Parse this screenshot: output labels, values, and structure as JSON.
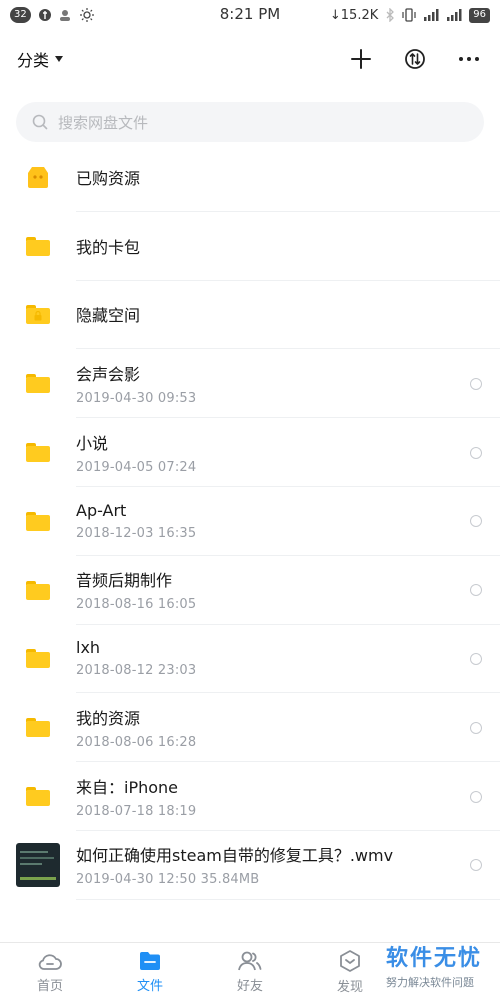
{
  "status_bar": {
    "notif_count": "32",
    "time": "8:21 PM",
    "net_speed": "↓15.2K",
    "battery": "96"
  },
  "header": {
    "category_label": "分类"
  },
  "search": {
    "placeholder": "搜索网盘文件"
  },
  "files": [
    {
      "name": "已购资源",
      "meta": "",
      "icon": "purchased-icon",
      "selectable": false
    },
    {
      "name": "我的卡包",
      "meta": "",
      "icon": "folder-icon",
      "selectable": false
    },
    {
      "name": "隐藏空间",
      "meta": "",
      "icon": "locked-folder-icon",
      "selectable": false
    },
    {
      "name": "会声会影",
      "meta": "2019-04-30  09:53",
      "icon": "folder-icon",
      "selectable": true
    },
    {
      "name": "小说",
      "meta": "2019-04-05  07:24",
      "icon": "folder-icon",
      "selectable": true
    },
    {
      "name": "Ap-Art",
      "meta": "2018-12-03  16:35",
      "icon": "folder-icon",
      "selectable": true
    },
    {
      "name": "音频后期制作",
      "meta": "2018-08-16  16:05",
      "icon": "folder-icon",
      "selectable": true
    },
    {
      "name": "lxh",
      "meta": "2018-08-12  23:03",
      "icon": "folder-icon",
      "selectable": true
    },
    {
      "name": "我的资源",
      "meta": "2018-08-06  16:28",
      "icon": "folder-icon",
      "selectable": true
    },
    {
      "name": "来自：iPhone",
      "meta": "2018-07-18  18:19",
      "icon": "folder-icon",
      "selectable": true
    },
    {
      "name": "如何正确使用steam自带的修复工具？.wmv",
      "meta": "2019-04-30  12:50   35.84MB",
      "icon": "video-thumbnail",
      "selectable": true
    }
  ],
  "tabs": [
    {
      "label": "首页",
      "icon": "cloud-home-icon"
    },
    {
      "label": "文件",
      "icon": "file-folder-icon"
    },
    {
      "label": "好友",
      "icon": "friends-icon"
    },
    {
      "label": "发现",
      "icon": "discover-icon"
    }
  ],
  "watermark": {
    "title": "软件无忧",
    "subtitle": "努力解决软件问题"
  },
  "colors": {
    "accent": "#1f8ff5",
    "folder": "#ffcb1f"
  }
}
